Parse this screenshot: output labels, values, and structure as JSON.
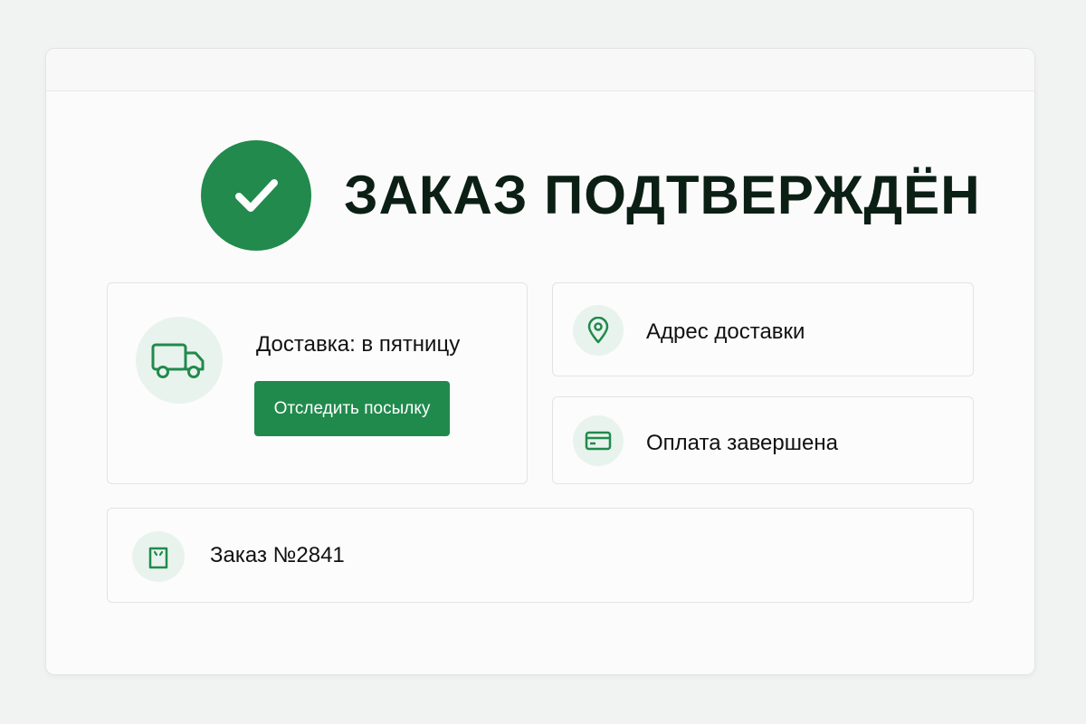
{
  "header": {
    "title": "ЗАКАЗ ПОДТВЕРЖДЁН",
    "icon": "checkmark-icon"
  },
  "delivery": {
    "label": "Доставка: в пятницу",
    "icon": "truck-icon",
    "track_button_label": "Отследить посылку"
  },
  "address": {
    "label": "Адрес доставки",
    "icon": "location-pin-icon"
  },
  "payment": {
    "label": "Оплата завершена",
    "icon": "credit-card-icon"
  },
  "order": {
    "label": "Заказ №2841",
    "icon": "shopping-bag-icon"
  },
  "colors": {
    "accent": "#218a4c",
    "icon_background": "#e9f3ed",
    "title_text": "#0b1f15",
    "page_background": "#f1f2f2",
    "card_border": "#e2e4e3"
  }
}
